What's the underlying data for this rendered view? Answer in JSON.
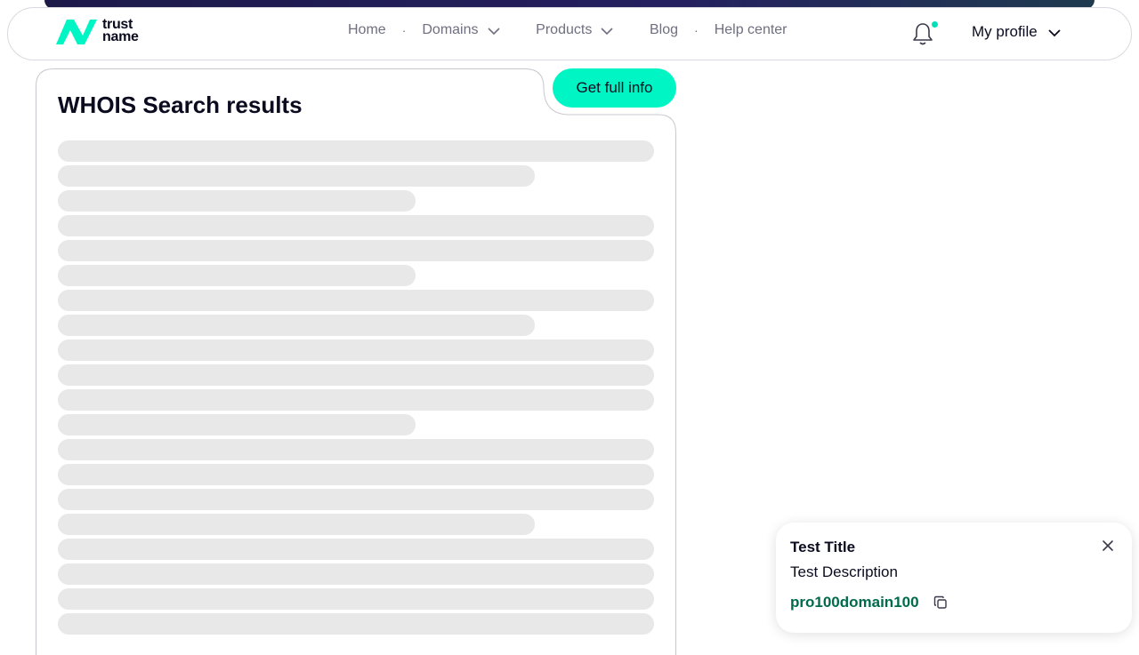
{
  "logo": {
    "line1": "trust",
    "line2": "name",
    "brand_color": "#00f5c4"
  },
  "nav": {
    "items": [
      {
        "label": "Home",
        "has_dropdown": false
      },
      {
        "label": "Domains",
        "has_dropdown": true
      },
      {
        "label": "Products",
        "has_dropdown": true
      },
      {
        "label": "Blog",
        "has_dropdown": false
      },
      {
        "label": "Help center",
        "has_dropdown": false
      }
    ],
    "separator": "·"
  },
  "header": {
    "notifications_icon": "bell-icon",
    "notification_dot_color": "#00e0b8",
    "profile_label": "My profile"
  },
  "results": {
    "title": "WHOIS Search results",
    "full_info_label": "Get full info",
    "loading": true
  },
  "toast": {
    "title": "Test Title",
    "description": "Test Description",
    "code": "pro100domain100",
    "close_icon": "close-icon",
    "copy_icon": "copy-icon"
  },
  "colors": {
    "accent": "#00f5c4",
    "code_text": "#006b4c",
    "skeleton": "#e8e8e8"
  }
}
